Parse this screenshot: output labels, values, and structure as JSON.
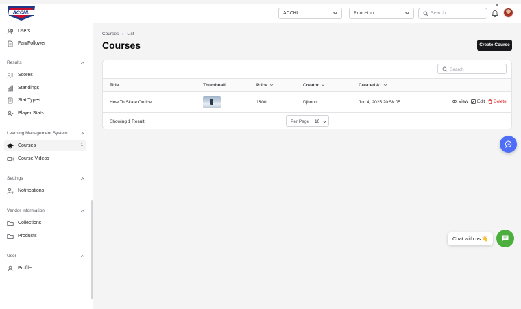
{
  "header": {
    "logo_text": "ACCHL",
    "league_select": "ACCHL",
    "team_select": "Princeton",
    "search_placeholder": "Search",
    "notification_count": "5"
  },
  "sidebar": {
    "top_items": [
      {
        "label": "Users",
        "icon": "users-icon"
      },
      {
        "label": "Fan/Follower",
        "icon": "file-icon"
      }
    ],
    "groups": [
      {
        "label": "Results",
        "items": [
          {
            "label": "Scores",
            "icon": "scores-icon"
          },
          {
            "label": "Standings",
            "icon": "bar-chart-icon"
          },
          {
            "label": "Stat Types",
            "icon": "document-icon"
          },
          {
            "label": "Player Stats",
            "icon": "player-icon"
          }
        ]
      },
      {
        "label": "Learning Management System",
        "items": [
          {
            "label": "Courses",
            "icon": "graduation-cap-icon",
            "badge": "1",
            "active": true
          },
          {
            "label": "Course Videos",
            "icon": "video-icon"
          }
        ]
      },
      {
        "label": "Settings",
        "items": [
          {
            "label": "Notifications",
            "icon": "user-bell-icon"
          }
        ]
      },
      {
        "label": "Vendor Information",
        "items": [
          {
            "label": "Collections",
            "icon": "folder-icon"
          },
          {
            "label": "Products",
            "icon": "folder-icon"
          }
        ]
      },
      {
        "label": "User",
        "items": [
          {
            "label": "Profile",
            "icon": "user-icon"
          }
        ]
      }
    ]
  },
  "main": {
    "breadcrumb": [
      "Courses",
      "List"
    ],
    "title": "Courses",
    "create_button": "Create Course",
    "table": {
      "search_placeholder": "Search",
      "columns": [
        "Title",
        "Thumbnail",
        "Price",
        "Creator",
        "Created At"
      ],
      "rows": [
        {
          "title": "How To Skate On Ice",
          "price": "1500",
          "creator": "Djhonn",
          "created_at": "Jun 4, 2025 20:58:05"
        }
      ],
      "actions": [
        "View",
        "Edit",
        "Delete"
      ],
      "footer": {
        "summary": "Showing 1 Result",
        "per_page_label": "Per Page",
        "per_page_value": "10"
      }
    }
  },
  "widgets": {
    "chat_label": "Chat with us 👋"
  },
  "colors": {
    "accent": "#4f6ef7",
    "chat": "#4cae3c",
    "danger": "#dc2626",
    "primary_button": "#18181b"
  }
}
